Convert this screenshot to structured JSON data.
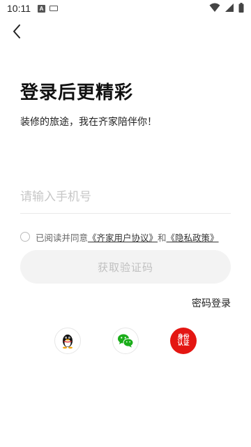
{
  "status_bar": {
    "time": "10:11",
    "left_icons": [
      "notification-a-icon",
      "keyboard-icon"
    ],
    "right_icons": [
      "wifi-icon",
      "signal-icon",
      "battery-icon"
    ]
  },
  "header": {
    "back_icon": "chevron-left-icon"
  },
  "title": "登录后更精彩",
  "subtitle": "装修的旅途，我在齐家陪伴你！",
  "phone": {
    "placeholder": "请输入手机号",
    "value": ""
  },
  "agreement": {
    "checked": false,
    "prefix": "已阅读并同意",
    "user_agreement": "《齐家用户协议》",
    "and": "和",
    "privacy_policy": "《隐私政策》"
  },
  "get_code_button": "获取验证码",
  "password_login": "密码登录",
  "social_logins": [
    {
      "name": "qq",
      "icon": "qq-penguin-icon"
    },
    {
      "name": "wechat",
      "icon": "wechat-icon"
    },
    {
      "name": "identity",
      "icon": "identity-auth-icon",
      "text": "身份认证"
    }
  ],
  "colors": {
    "background": "#ffffff",
    "button_bg": "#f3f3f3",
    "button_text": "#c0c0c0",
    "wechat_green": "#1aad19",
    "identity_red": "#e41612"
  }
}
